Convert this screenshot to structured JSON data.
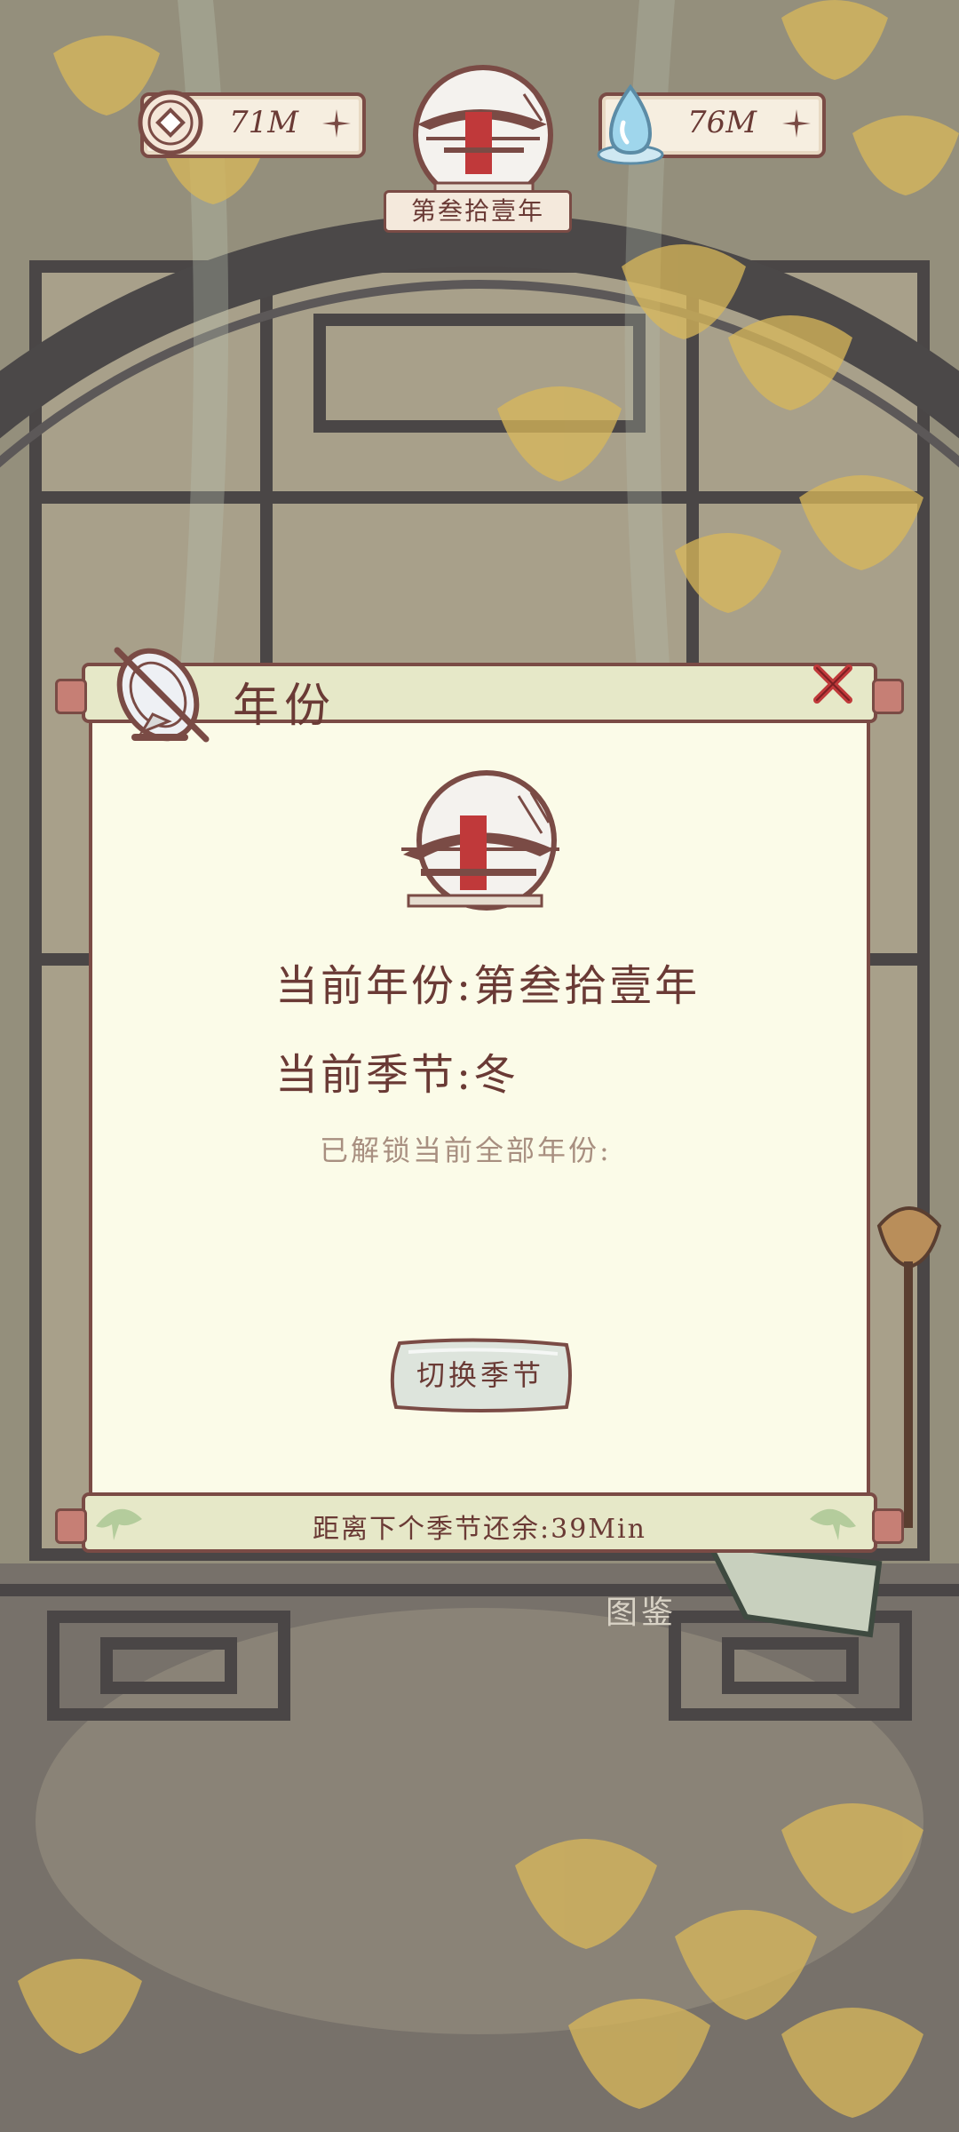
{
  "hud": {
    "coins": "71M",
    "water": "76M",
    "year_banner": "第叁拾壹年"
  },
  "dialog": {
    "title": "年份",
    "current_year": "当前年份:第叁拾壹年",
    "current_season": "当前季节:冬",
    "unlocked_text": "已解锁当前全部年份:",
    "switch_button": "切换季节",
    "timer": "距离下个季节还余:39Min"
  },
  "background": {
    "label": "图鉴"
  },
  "colors": {
    "accent_border": "#7a4b45",
    "text_brown": "#6a3a35",
    "panel_bg": "#fbfbe8",
    "roll_bg": "#e6e8c8",
    "ginkgo": "#d9b85a"
  }
}
